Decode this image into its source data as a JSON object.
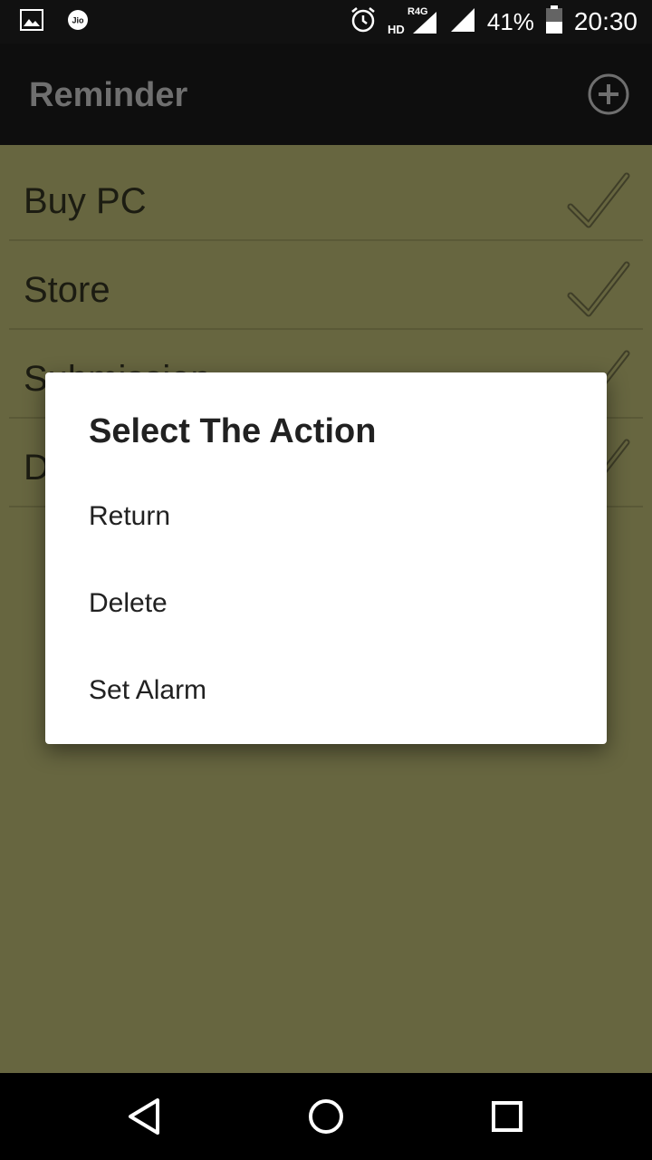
{
  "status_bar": {
    "left_icons": [
      "image-icon",
      "jio-icon"
    ],
    "jio_text": "Jio",
    "right_icons": [
      "alarm-icon",
      "hd-icon",
      "signal-r4g-icon",
      "signal-icon",
      "battery-icon"
    ],
    "network_label": "R4G",
    "hd_label": "HD",
    "battery_percent": "41%",
    "time": "20:30"
  },
  "app_bar": {
    "title": "Reminder",
    "add_icon": "add-circle-icon"
  },
  "list": {
    "items": [
      {
        "label": "Buy PC"
      },
      {
        "label": "Store"
      },
      {
        "label": "Submission"
      },
      {
        "label": "D"
      }
    ]
  },
  "dialog": {
    "title": "Select The Action",
    "options": [
      "Return",
      "Delete",
      "Set Alarm"
    ]
  },
  "nav_bar": {
    "icons": [
      "back-icon",
      "home-icon",
      "recents-icon"
    ]
  },
  "colors": {
    "list_background": "#676640",
    "app_bar": "#0e0e0e",
    "dialog_background": "#ffffff"
  }
}
